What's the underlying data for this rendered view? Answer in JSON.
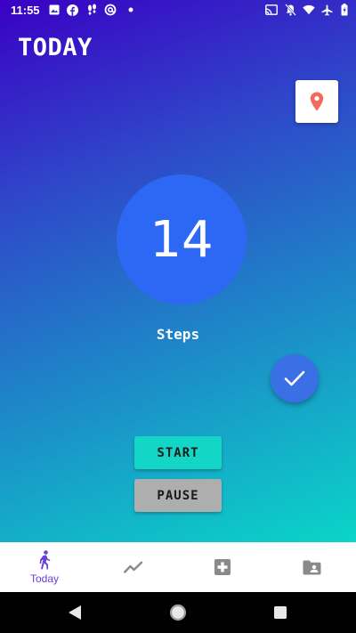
{
  "status_bar": {
    "time": "11:55",
    "left_icons": [
      "image-icon",
      "facebook-icon",
      "footsteps-icon",
      "at-sign-icon",
      "dot-icon"
    ],
    "right_icons": [
      "cast-icon",
      "mute-icon",
      "wifi-icon",
      "airplane-icon",
      "battery-icon"
    ]
  },
  "header": {
    "title": "TODAY"
  },
  "location_button": {
    "icon": "location-pin-icon",
    "icon_color": "#f26b5b"
  },
  "step_counter": {
    "value": "14",
    "label": "Steps",
    "circle_color": "#2d68f5"
  },
  "fab": {
    "icon": "check-icon"
  },
  "controls": {
    "start_label": "START",
    "pause_label": "PAUSE",
    "start_color": "#14d6c6",
    "pause_color": "#aeaeae"
  },
  "bottom_nav": {
    "items": [
      {
        "label": "Today",
        "icon": "walking-icon",
        "active": true
      },
      {
        "label": "",
        "icon": "trending-icon",
        "active": false
      },
      {
        "label": "",
        "icon": "medical-cross-icon",
        "active": false
      },
      {
        "label": "",
        "icon": "contact-folder-icon",
        "active": false
      }
    ],
    "active_color": "#6a3fd6",
    "inactive_color": "#8a8a8a"
  },
  "system_nav": {
    "icons": [
      "back-icon",
      "home-icon",
      "recents-icon"
    ]
  }
}
